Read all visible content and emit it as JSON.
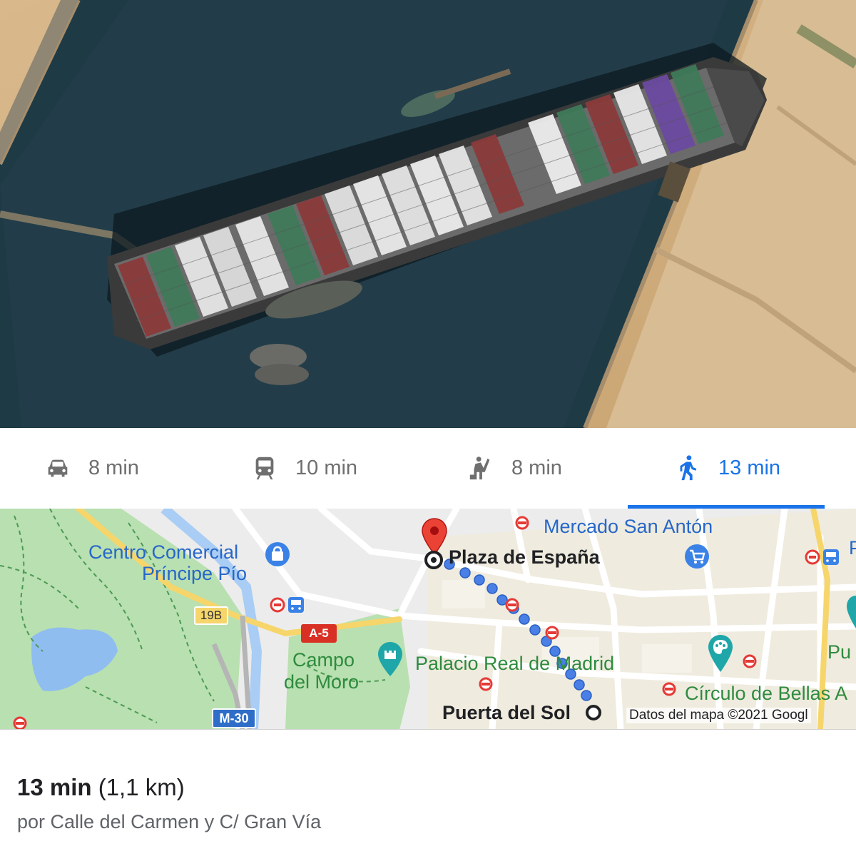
{
  "travel_modes": [
    {
      "icon": "car-icon",
      "label": "8 min",
      "active": false
    },
    {
      "icon": "train-icon",
      "label": "10 min",
      "active": false
    },
    {
      "icon": "rideshare-icon",
      "label": "8 min",
      "active": false
    },
    {
      "icon": "walking-icon",
      "label": "13 min",
      "active": true
    }
  ],
  "map": {
    "places": {
      "centro_comercial_line1": "Centro Comercial",
      "centro_comercial_line2": "Príncipe Pío",
      "mercado": "Mercado San Antón",
      "campo_line1": "Campo",
      "campo_line2": "del Moro",
      "palacio": "Palacio Real de Madrid",
      "circulo": "Círculo de Bellas A",
      "plaza_espana": "Plaza de España",
      "puerta_sol": "Puerta del Sol",
      "edge_p": "P",
      "edge_pu": "Pu"
    },
    "road_shields": {
      "a5": "A-5",
      "m30": "M-30",
      "r19b": "19B"
    },
    "credit": "Datos del mapa ©2021 Googl"
  },
  "summary": {
    "duration": "13 min",
    "distance": "(1,1 km)",
    "via": "por Calle del Carmen y C/ Gran Vía"
  },
  "colors": {
    "accent": "#1a73e8",
    "route": "#4a7fe6",
    "pin": "#ea4335",
    "park": "#b9e0b0",
    "water": "#8fbdf0"
  }
}
